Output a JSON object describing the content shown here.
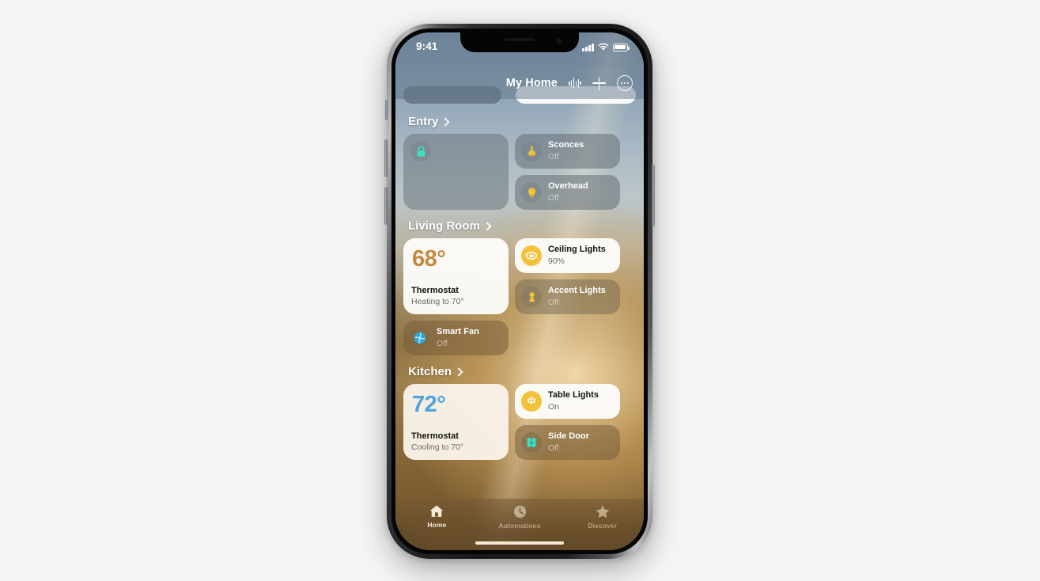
{
  "device": {
    "name": "iphone-13-pro",
    "frame_color": "#1d1e21"
  },
  "status_bar": {
    "time": "9:41",
    "cellular_icon": "signal-bars-icon",
    "wifi_icon": "wifi-icon",
    "battery_icon": "battery-icon"
  },
  "nav_bar": {
    "title": "My Home",
    "intercom_icon": "waveform-icon",
    "add_icon": "plus-icon",
    "more_icon": "ellipsis-circle-icon"
  },
  "sections": [
    {
      "name": "Entry",
      "chevron_icon": "chevron-right-icon",
      "big_tile": {
        "type": "lock",
        "icon": "lock-closed-icon",
        "icon_color": "#3ee0c2",
        "state_on": false,
        "title": "",
        "subtitle": ""
      },
      "tiles": [
        {
          "name": "Sconces",
          "state": "Off",
          "icon": "sconce-lamp-icon",
          "icon_color": "#f2c23c",
          "on": false
        },
        {
          "name": "Overhead",
          "state": "Off",
          "icon": "light-bulb-icon",
          "icon_color": "#f2c23c",
          "on": false
        }
      ]
    },
    {
      "name": "Living Room",
      "chevron_icon": "chevron-right-icon",
      "big_tile": {
        "type": "thermostat",
        "temperature": "68°",
        "temp_mode": "heating",
        "temp_color": "#c58a3e",
        "title": "Thermostat",
        "subtitle": "Heating to 70°",
        "state_on": true
      },
      "tiles": [
        {
          "name": "Ceiling Lights",
          "state": "90%",
          "icon": "ceiling-light-icon",
          "icon_color": "#f2c23c",
          "on": true
        },
        {
          "name": "Accent Lights",
          "state": "Off",
          "icon": "accent-lamp-icon",
          "icon_color": "#f2c23c",
          "on": false
        }
      ],
      "extra_tiles": [
        {
          "name": "Smart Fan",
          "state": "Off",
          "icon": "fan-icon",
          "icon_color": "#2ea7e0",
          "on": false
        }
      ]
    },
    {
      "name": "Kitchen",
      "chevron_icon": "chevron-right-icon",
      "big_tile": {
        "type": "thermostat",
        "temperature": "72°",
        "temp_mode": "cooling",
        "temp_color": "#4da3dd",
        "title": "Thermostat",
        "subtitle": "Cooling to 70°",
        "state_on": true
      },
      "tiles": [
        {
          "name": "Table Lights",
          "state": "On",
          "icon": "chandelier-icon",
          "icon_color": "#f2c23c",
          "on": true
        },
        {
          "name": "Side Door",
          "state": "Off",
          "icon": "door-icon",
          "icon_color": "#3ee0c2",
          "on": false
        }
      ]
    }
  ],
  "tab_bar": {
    "tabs": [
      {
        "label": "Home",
        "icon": "house-icon",
        "active": true
      },
      {
        "label": "Automations",
        "icon": "clock-icon",
        "active": false
      },
      {
        "label": "Discover",
        "icon": "star-icon",
        "active": false
      }
    ]
  },
  "home_indicator": "home-indicator-bar"
}
